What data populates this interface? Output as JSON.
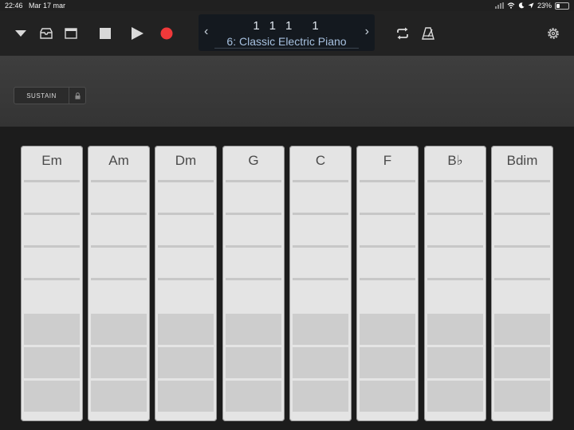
{
  "status_bar": {
    "time": "22:46",
    "date": "Mar 17 mar",
    "battery": "23%",
    "battery_level": 0.23
  },
  "transport": {
    "position": [
      "1",
      "1",
      "1",
      "1"
    ],
    "instrument": "6: Classic Electric Piano",
    "prev_arrow": "‹",
    "next_arrow": "›",
    "icons": [
      "view-menu-icon",
      "browser-icon",
      "tracks-view-icon",
      "stop-icon",
      "play-icon",
      "record-icon",
      "loop-icon",
      "metronome-icon",
      "settings-icon"
    ],
    "record_color": "#f0393a"
  },
  "controls": {
    "sustain_label": "SUSTAIN"
  },
  "chords": [
    {
      "name": "Em"
    },
    {
      "name": "Am"
    },
    {
      "name": "Dm"
    },
    {
      "name": "G"
    },
    {
      "name": "C"
    },
    {
      "name": "F"
    },
    {
      "name": "B♭"
    },
    {
      "name": "Bdim"
    }
  ]
}
